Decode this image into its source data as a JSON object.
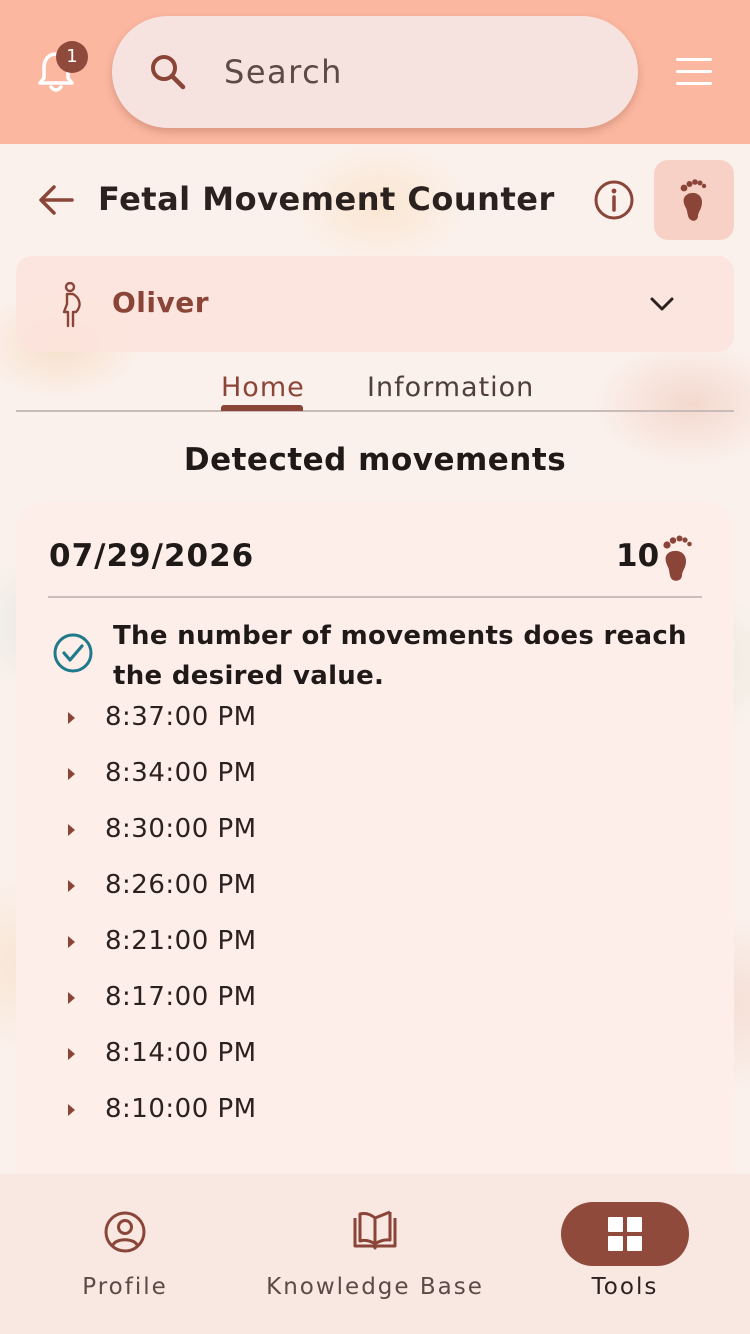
{
  "header": {
    "notification_count": "1",
    "search_placeholder": "Search"
  },
  "page": {
    "title": "Fetal Movement Counter"
  },
  "selector": {
    "name": "Oliver"
  },
  "tabs": [
    {
      "label": "Home",
      "active": true
    },
    {
      "label": "Information",
      "active": false
    }
  ],
  "section_title": "Detected movements",
  "card": {
    "date": "07/29/2026",
    "count": "10",
    "status": "The number of movements does reach the desired value.",
    "times": [
      "8:37:00 PM",
      "8:34:00 PM",
      "8:30:00 PM",
      "8:26:00 PM",
      "8:21:00 PM",
      "8:17:00 PM",
      "8:14:00 PM",
      "8:10:00 PM"
    ]
  },
  "bottom_nav": [
    {
      "label": "Profile",
      "icon": "profile-icon",
      "active": false
    },
    {
      "label": "Knowledge Base",
      "icon": "book-icon",
      "active": false
    },
    {
      "label": "Tools",
      "icon": "grid-icon",
      "active": true
    }
  ],
  "colors": {
    "accent": "#8a4538",
    "topbar": "#fbb7a0",
    "success": "#1f7a8c"
  }
}
